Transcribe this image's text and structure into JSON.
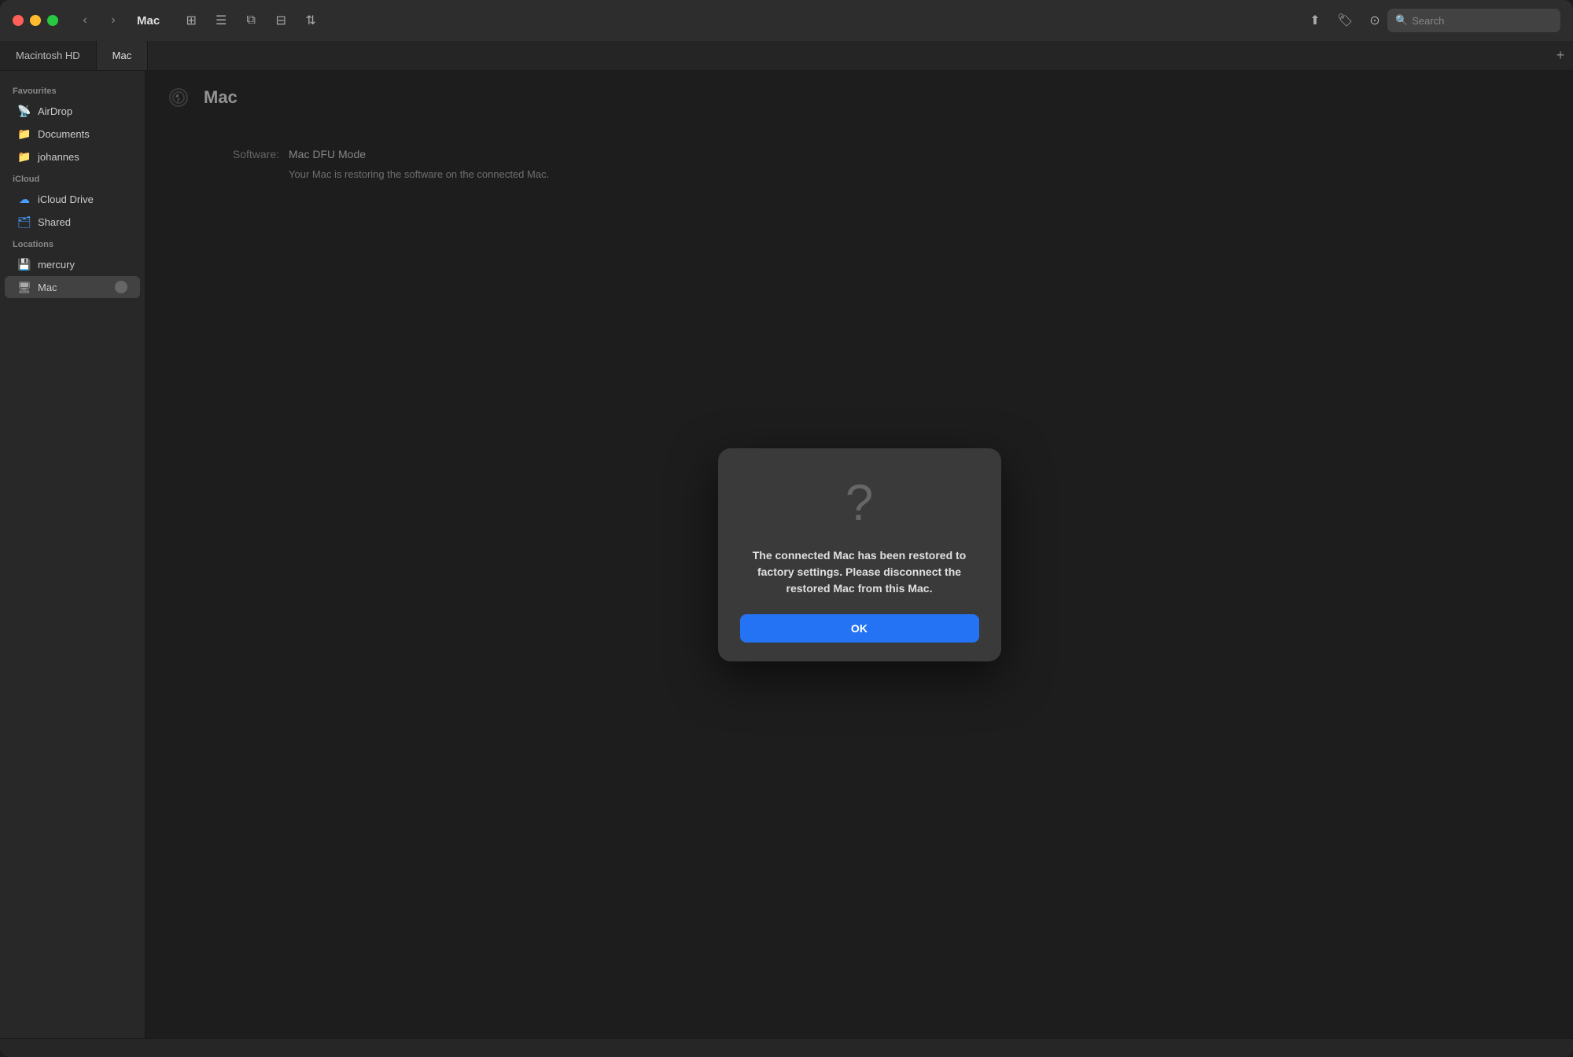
{
  "window": {
    "title": "Mac"
  },
  "titlebar": {
    "back_label": "‹",
    "forward_label": "›",
    "title": "Mac",
    "search_placeholder": "Search"
  },
  "tabs": [
    {
      "label": "Macintosh HD",
      "active": false
    },
    {
      "label": "Mac",
      "active": true
    }
  ],
  "tab_add_label": "+",
  "sidebar": {
    "sections": [
      {
        "label": "Favourites",
        "items": [
          {
            "name": "AirDrop",
            "icon": "airdrop"
          },
          {
            "name": "Documents",
            "icon": "folder"
          },
          {
            "name": "johannes",
            "icon": "folder"
          }
        ]
      },
      {
        "label": "iCloud",
        "items": [
          {
            "name": "iCloud Drive",
            "icon": "cloud"
          },
          {
            "name": "Shared",
            "icon": "shared-folder"
          }
        ]
      },
      {
        "label": "Locations",
        "items": [
          {
            "name": "mercury",
            "icon": "hdd"
          },
          {
            "name": "Mac",
            "icon": "mac",
            "active": true,
            "spinner": true
          }
        ]
      }
    ]
  },
  "page": {
    "title": "Mac",
    "software_label": "Software:",
    "software_value": "Mac DFU Mode",
    "description": "Your Mac is restoring the software on the connected Mac."
  },
  "modal": {
    "message": "The connected Mac has been restored to factory settings. Please disconnect the restored Mac from this Mac.",
    "ok_label": "OK"
  }
}
